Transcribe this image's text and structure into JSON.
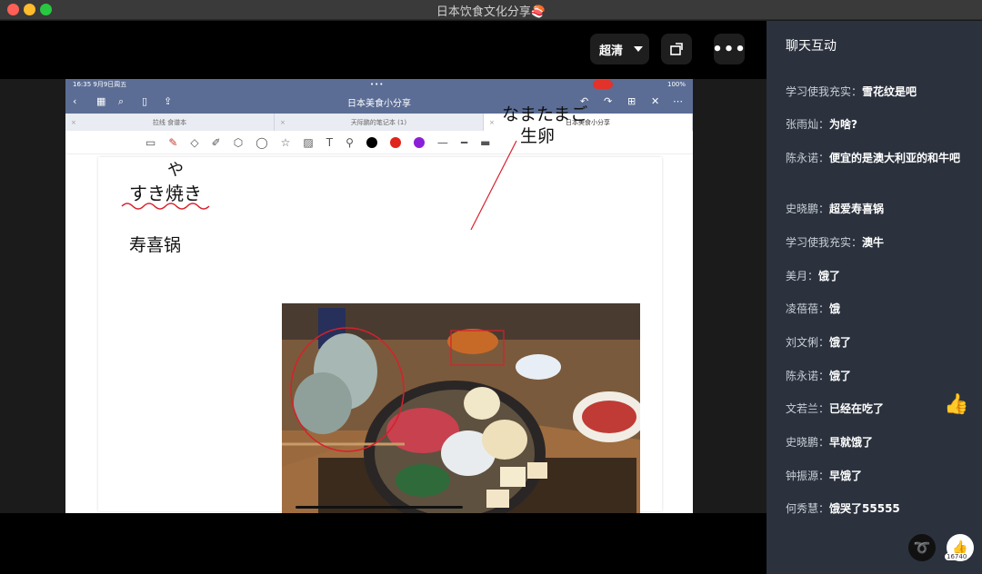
{
  "window": {
    "title": "日本饮食文化分享🍣"
  },
  "player": {
    "quality_label": "超清",
    "share_icon": "share-window-icon",
    "more_icon": "more-icon"
  },
  "ipad": {
    "status": {
      "time": "16:35 9月9日周五",
      "battery": "100%"
    },
    "doc_title": "日本美食小分享",
    "tabs": [
      "拉线 食谱本",
      "天际鹏的笔记本 (1)",
      "日本美食小分享"
    ],
    "colors": [
      "#000000",
      "#e0231b",
      "#8a1fd8"
    ]
  },
  "notes": {
    "ya": "や",
    "sukiyaki": "すき焼き",
    "sukiyaki_cn": "寿喜锅",
    "namatamago": "なまたまご",
    "raw_egg": "生卵"
  },
  "chat": {
    "title": "聊天互动",
    "messages": [
      {
        "who": "学习使我充实：",
        "text": "雪花纹是吧"
      },
      {
        "who": "张雨灿：",
        "text": "为啥?"
      },
      {
        "who": "陈永诺：",
        "text": "便宜的是澳大利亚的和牛吧"
      },
      {
        "who": "史晓鹏：",
        "text": "超爱寿喜锅"
      },
      {
        "who": "学习使我充实：",
        "text": "澳牛"
      },
      {
        "who": "美月：",
        "text": "饿了"
      },
      {
        "who": "凌蓓蓓：",
        "text": "饿"
      },
      {
        "who": "刘文俐：",
        "text": "饿了"
      },
      {
        "who": "陈永诺：",
        "text": "饿了"
      },
      {
        "who": "文若兰：",
        "text": "已经在吃了"
      },
      {
        "who": "史晓鹏：",
        "text": "早就饿了"
      },
      {
        "who": "钟振源：",
        "text": "早饿了"
      },
      {
        "who": "何秀慧：",
        "text": "饿哭了55555"
      }
    ],
    "like_count": "16740"
  }
}
